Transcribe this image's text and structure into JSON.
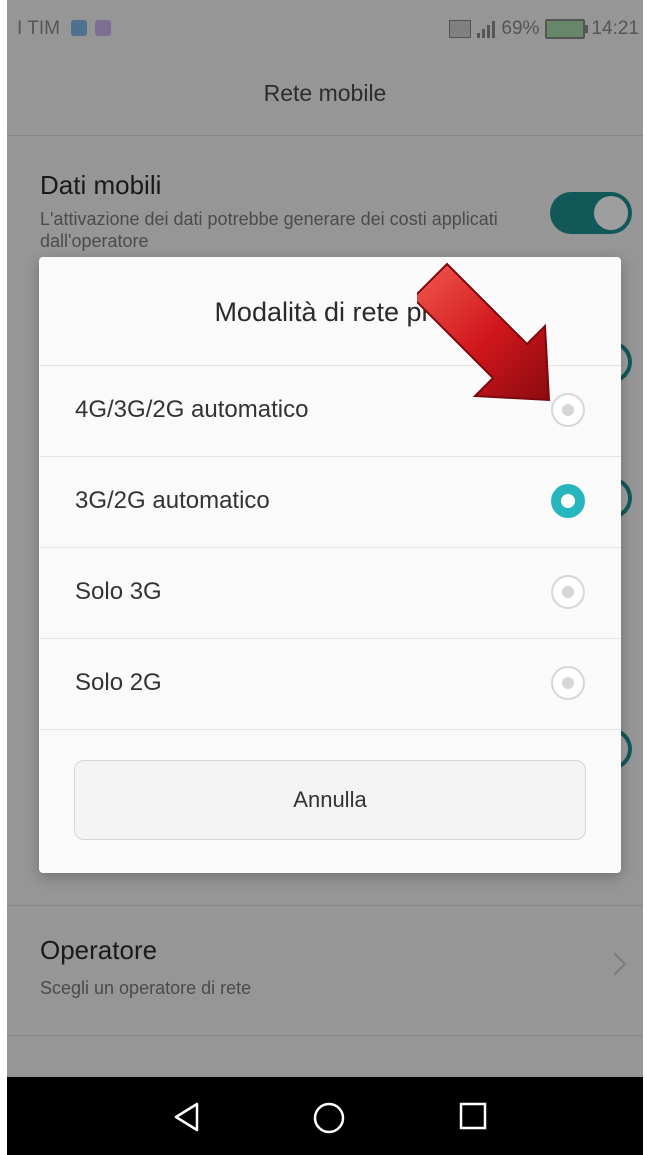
{
  "status_bar": {
    "carrier": "I TIM",
    "battery": "69%",
    "time": "14:21"
  },
  "app_title": "Rete mobile",
  "settings": {
    "dati_mobili": {
      "title": "Dati mobili",
      "subtitle": "L'attivazione dei dati potrebbe generare dei costi applicati dall'operatore",
      "enabled": true
    },
    "operatore": {
      "title": "Operatore",
      "subtitle": "Scegli un operatore di rete"
    }
  },
  "dialog": {
    "title": "Modalità di rete pre",
    "options": [
      {
        "label": "4G/3G/2G automatico",
        "selected": false
      },
      {
        "label": "3G/2G automatico",
        "selected": true
      },
      {
        "label": "Solo 3G",
        "selected": false
      },
      {
        "label": "Solo 2G",
        "selected": false
      }
    ],
    "cancel_label": "Annulla"
  },
  "colors": {
    "accent": "#27b6bd",
    "toggle": "#1f8f8e",
    "arrow": "#d0161c"
  },
  "icons": [
    "sim-icon",
    "signal-icon",
    "battery-icon",
    "chevron-right-icon",
    "back-icon",
    "home-icon",
    "recents-icon",
    "red-arrow-annotation"
  ]
}
